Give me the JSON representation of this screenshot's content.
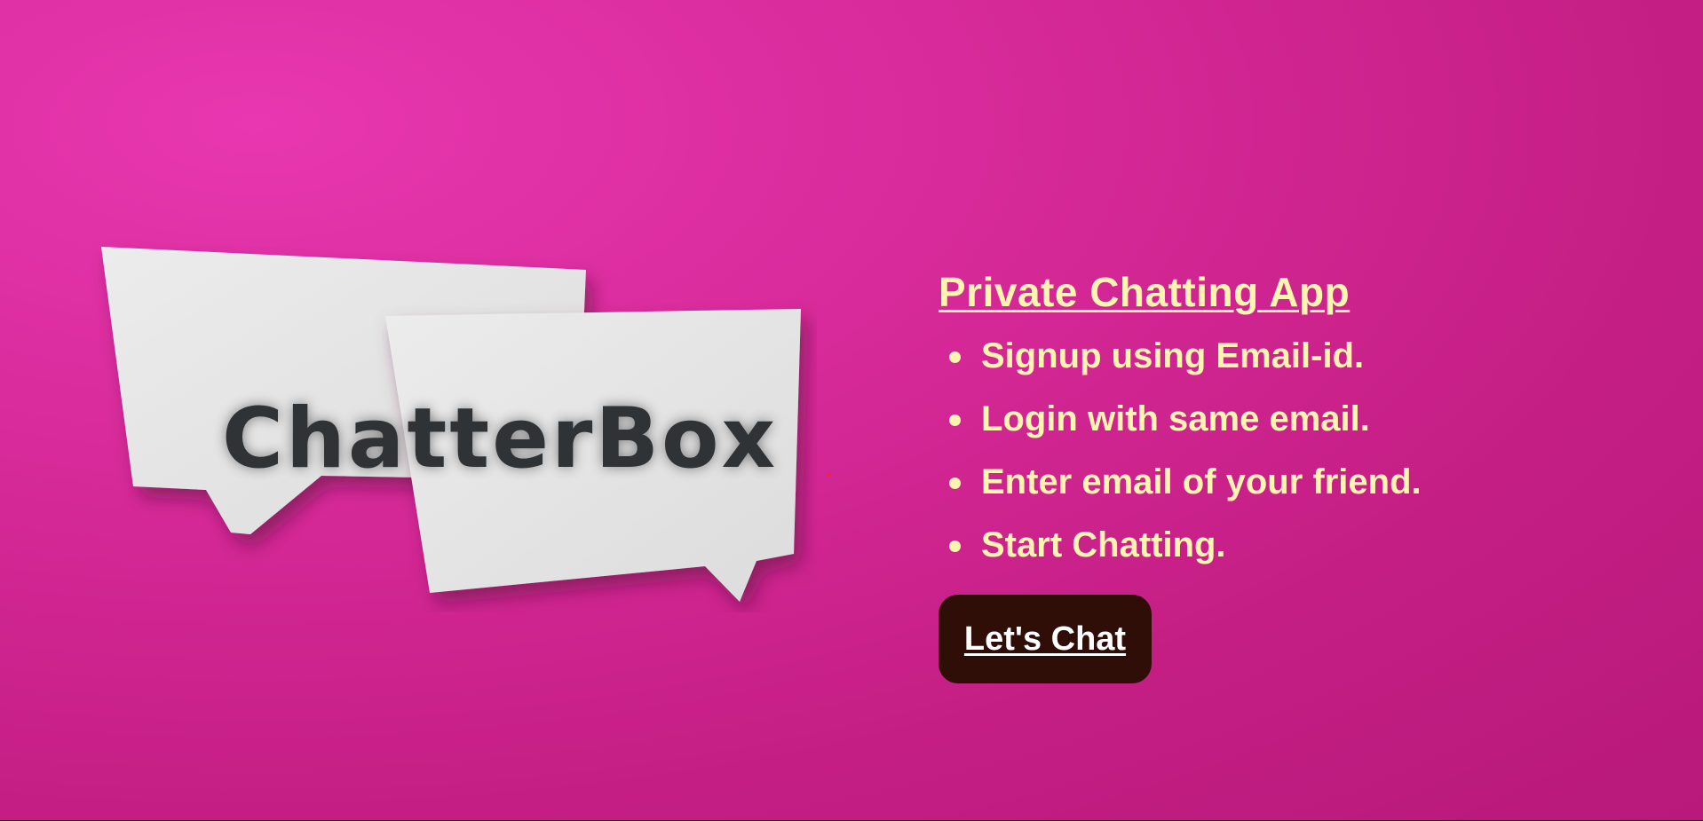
{
  "hero": {
    "logo_text": "ChatterBox",
    "title": "Private Chatting App",
    "steps": [
      "Signup using Email-id.",
      "Login with same email.",
      "Enter email of your friend.",
      "Start Chatting."
    ],
    "cta_label": "Let's Chat"
  },
  "colors": {
    "background": "#d82a9a",
    "text_accent": "#fff4b0",
    "button_bg": "#2e0e07",
    "button_text": "#ffffff",
    "logo_text": "#2f3336"
  },
  "icons": {
    "bullet": "bullet-dot-icon",
    "hero_image": "speech-bubbles-icon"
  }
}
